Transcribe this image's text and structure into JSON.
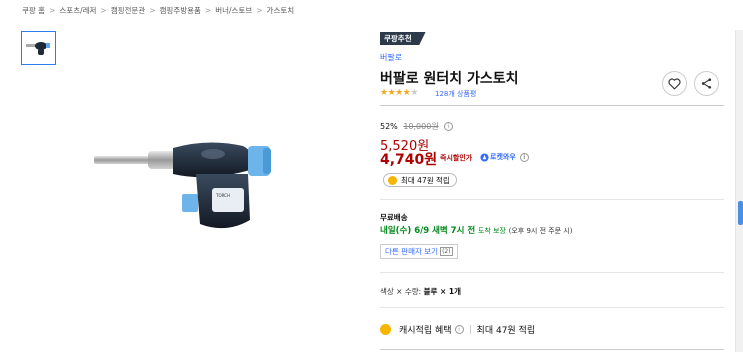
{
  "breadcrumb": [
    "쿠팡 홈",
    "스포츠/레저",
    "캠핑전문관",
    "캠핑주방용품",
    "버너/스토브",
    "가스토치"
  ],
  "breadcrumb_sep": ">",
  "product": {
    "badge": "쿠팡추천",
    "brand": "버팔로",
    "title": "버팔로 원터치 가스토치",
    "rating": 4.0,
    "review_count": "128개 상품평"
  },
  "price": {
    "discount_rate": "52%",
    "original_price": "10,000원",
    "sale_price": "5,520원",
    "instant_price": "4,740원",
    "instant_label": "즉시할인가",
    "rocket_label": "로켓와우"
  },
  "reward": {
    "pill_label": "최대 47원 적립"
  },
  "shipping": {
    "title": "무료배송",
    "date": "내일(수) 6/9 새벽 7시 전",
    "guarantee": "도착 보장",
    "order_note": "(오후 9시 전 주문 시)"
  },
  "seller": {
    "button_label": "다른 판매자 보기",
    "count": "(2)"
  },
  "option": {
    "prefix": "색상 × 수량:",
    "value": "블루 × 1개"
  },
  "cash": {
    "label": "캐시적립 혜택",
    "max_label": "최대 47원 적립"
  },
  "icons": {
    "heart": "heart-icon",
    "share": "share-icon",
    "info": "info-icon",
    "coin": "coin-icon",
    "rocket": "rocket-icon"
  },
  "colors": {
    "price_red": "#ae0000",
    "link_blue": "#346aff",
    "ship_green": "#00891a",
    "star_orange": "#f5a623",
    "coin_gold": "#f7b500"
  }
}
